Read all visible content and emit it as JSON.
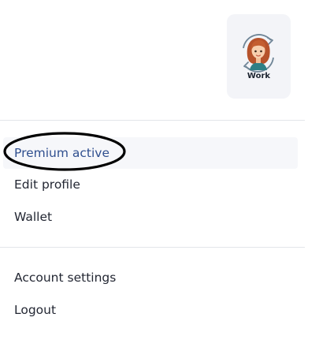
{
  "profile": {
    "label": "Work",
    "icon": "user-avatar-with-switch-arrows"
  },
  "menu": {
    "premium": "Premium active",
    "edit_profile": "Edit profile",
    "wallet": "Wallet",
    "account_settings": "Account settings",
    "logout": "Logout"
  },
  "colors": {
    "highlight_text": "#2f4f8f",
    "highlight_bg": "#f6f7fa",
    "profile_card_bg": "#f3f4f8"
  }
}
